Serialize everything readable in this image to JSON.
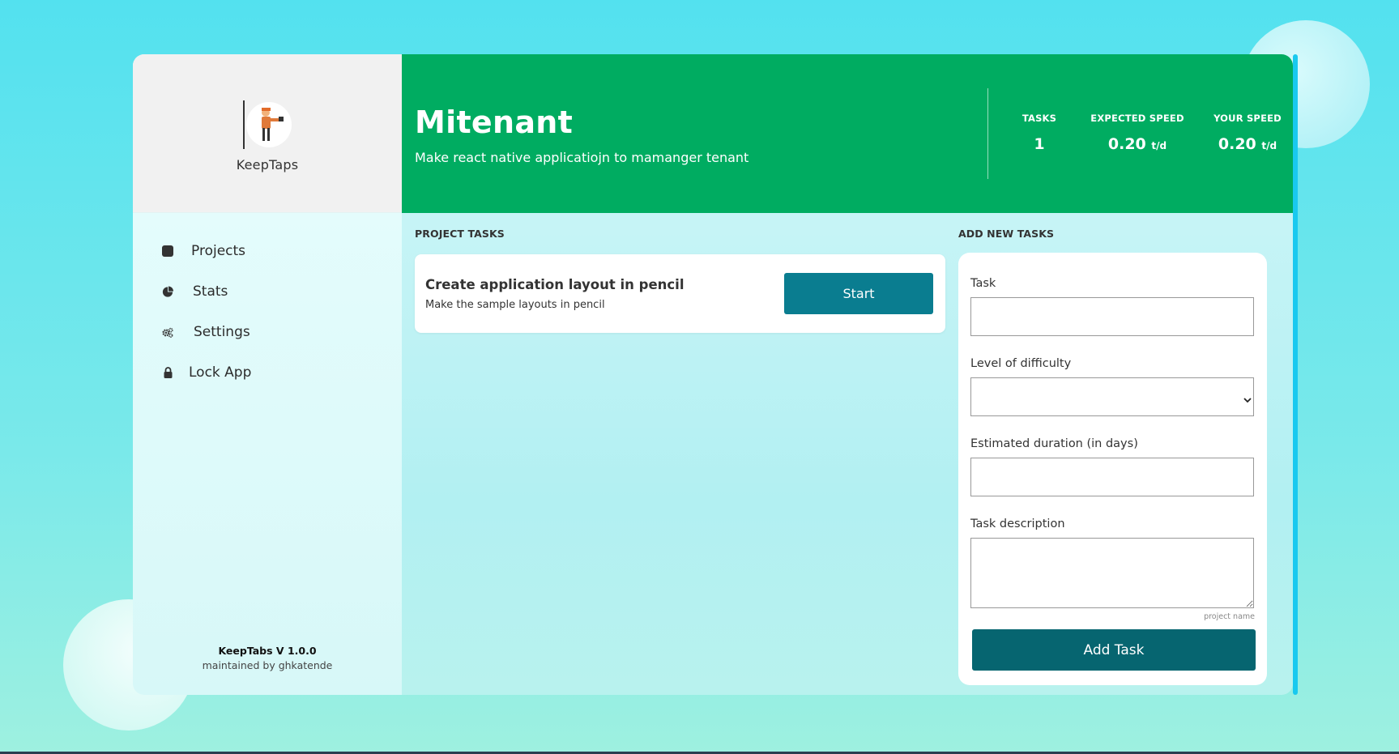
{
  "brand": {
    "name": "KeepTaps"
  },
  "sidebar": {
    "items": [
      {
        "label": "Projects",
        "icon": "square-icon"
      },
      {
        "label": "Stats",
        "icon": "pie-chart-icon"
      },
      {
        "label": "Settings",
        "icon": "gears-icon"
      },
      {
        "label": "Lock App",
        "icon": "lock-icon"
      }
    ],
    "footer": {
      "version": "KeepTabs V 1.0.0",
      "credit": "maintained by ghkatende"
    }
  },
  "header": {
    "title": "Mitenant",
    "description": "Make react native applicatiojn to mamanger tenant",
    "stats": [
      {
        "label": "TASKS",
        "value": "1",
        "unit": ""
      },
      {
        "label": "EXPECTED SPEED",
        "value": "0.20",
        "unit": "t/d"
      },
      {
        "label": "YOUR SPEED",
        "value": "0.20",
        "unit": "t/d"
      }
    ]
  },
  "project_tasks": {
    "title": "PROJECT TASKS",
    "tasks": [
      {
        "title": "Create application layout in pencil",
        "description": "Make the sample layouts in pencil",
        "action_label": "Start"
      }
    ]
  },
  "add_task": {
    "title": "ADD NEW TASKS",
    "task_label": "Task",
    "task_value": "",
    "difficulty_label": "Level of difficulty",
    "difficulty_value": "",
    "duration_label": "Estimated duration (in days)",
    "duration_value": "",
    "description_label": "Task description",
    "description_value": "",
    "hint": "project name",
    "submit_label": "Add Task"
  },
  "colors": {
    "header_green": "#00ac61",
    "start_button": "#0a7d90",
    "add_button": "#066570",
    "scrollbar": "#19c9ef"
  }
}
